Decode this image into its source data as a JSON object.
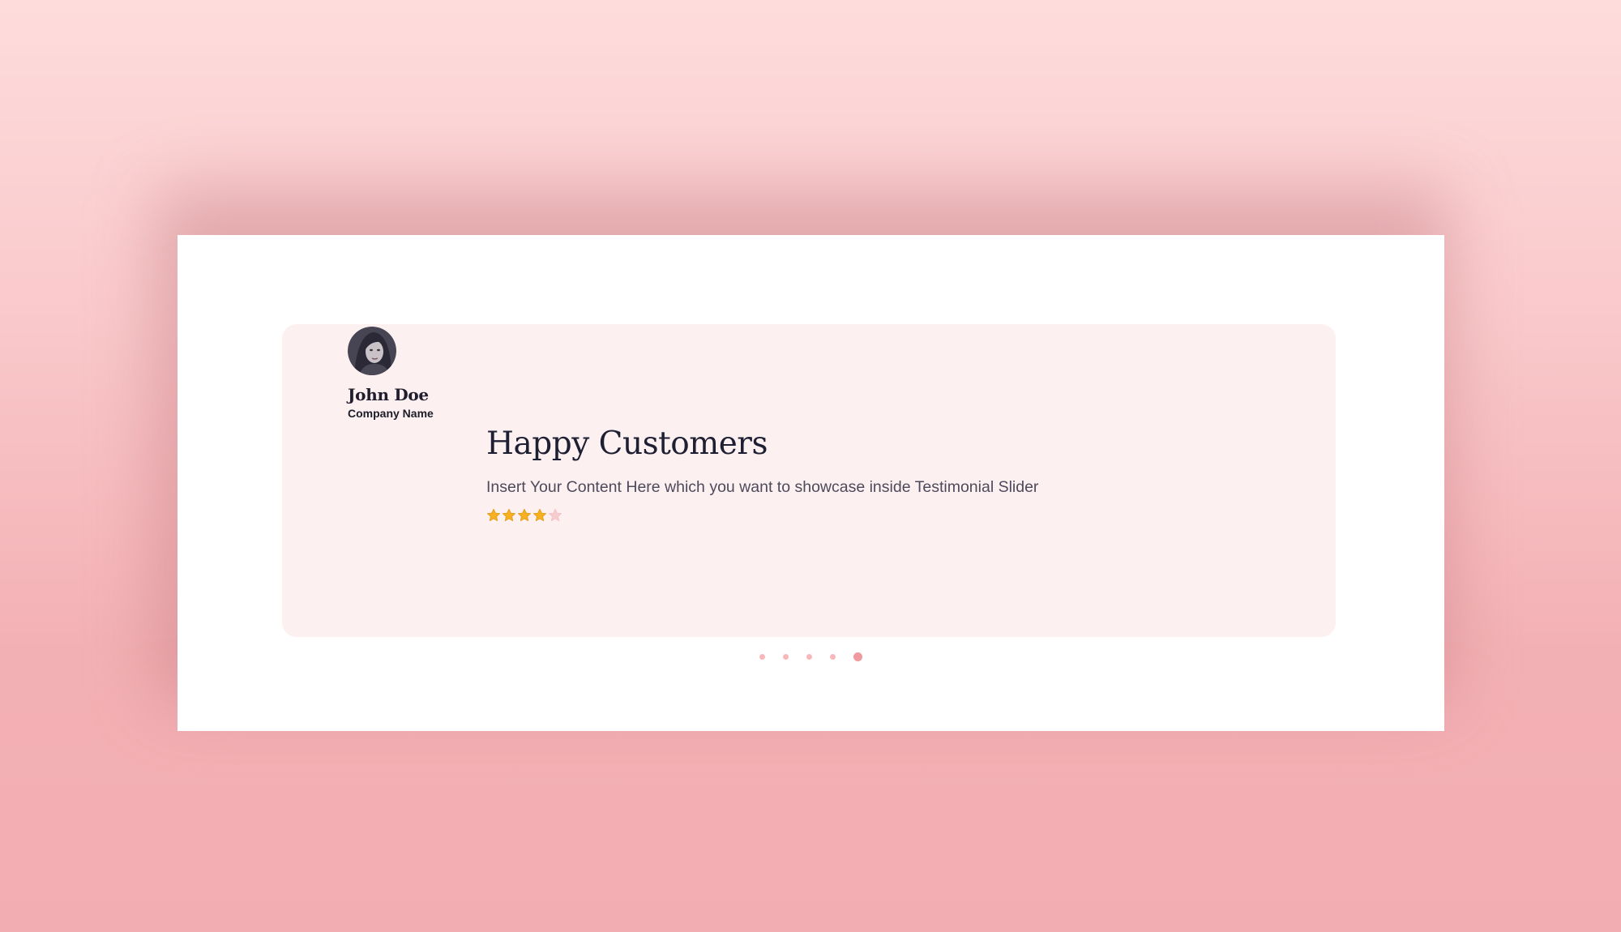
{
  "testimonial": {
    "author_name": "John Doe",
    "company_name": "Company Name",
    "headline": "Happy Customers",
    "body": "Insert Your Content Here which you want to showcase inside Testimonial Slider",
    "rating": 4,
    "rating_max": 5,
    "star_color": "#f5b121",
    "star_empty_color": "#f6cdcf"
  },
  "slider": {
    "dot_count": 5,
    "active_index": 4,
    "dot_color": "#f6b8bb",
    "active_dot_color": "#ef9a9f"
  },
  "colors": {
    "card_background": "#fdf0f0",
    "frame_background": "#ffffff",
    "page_background": "#f9c8ca"
  }
}
